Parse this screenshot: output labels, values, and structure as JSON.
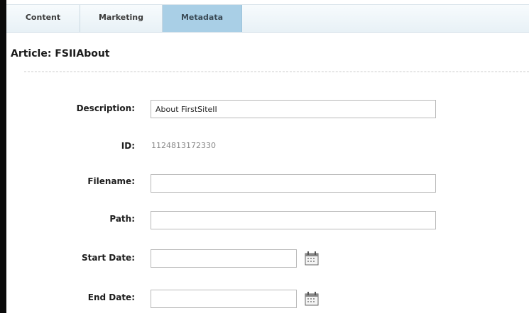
{
  "tabs": [
    {
      "label": "Content",
      "active": false
    },
    {
      "label": "Marketing",
      "active": false
    },
    {
      "label": "Metadata",
      "active": true
    }
  ],
  "page_title": "Article: FSIIAbout",
  "form": {
    "description": {
      "label": "Description:",
      "value": "About FirstSiteII"
    },
    "id": {
      "label": "ID:",
      "value": "1124813172330"
    },
    "filename": {
      "label": "Filename:",
      "value": ""
    },
    "path": {
      "label": "Path:",
      "value": ""
    },
    "start_date": {
      "label": "Start Date:",
      "value": "",
      "icon": "calendar-icon"
    },
    "end_date": {
      "label": "End Date:",
      "value": "",
      "icon": "calendar-icon"
    }
  },
  "colors": {
    "active_tab": "#a9cfe6",
    "tabbar": "#e8f1f6"
  }
}
